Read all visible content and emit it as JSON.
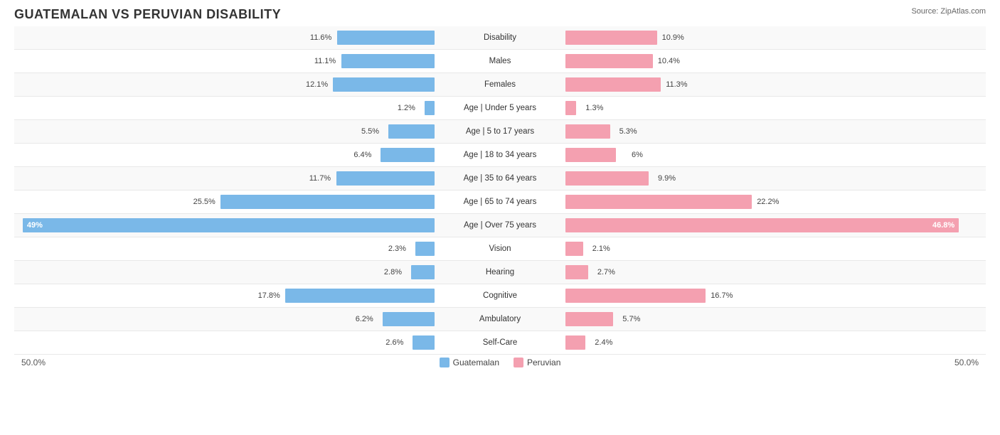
{
  "title": "GUATEMALAN VS PERUVIAN DISABILITY",
  "source": "Source: ZipAtlas.com",
  "footer": {
    "left": "50.0%",
    "right": "50.0%"
  },
  "legend": {
    "guatemalan_label": "Guatemalan",
    "peruvian_label": "Peruvian",
    "guatemalan_color": "#7ab8e8",
    "peruvian_color": "#f4a0b0"
  },
  "rows": [
    {
      "label": "Disability",
      "guatemalan": 11.6,
      "peruvian": 10.9,
      "max": 50
    },
    {
      "label": "Males",
      "guatemalan": 11.1,
      "peruvian": 10.4,
      "max": 50
    },
    {
      "label": "Females",
      "guatemalan": 12.1,
      "peruvian": 11.3,
      "max": 50
    },
    {
      "label": "Age | Under 5 years",
      "guatemalan": 1.2,
      "peruvian": 1.3,
      "max": 50
    },
    {
      "label": "Age | 5 to 17 years",
      "guatemalan": 5.5,
      "peruvian": 5.3,
      "max": 50
    },
    {
      "label": "Age | 18 to 34 years",
      "guatemalan": 6.4,
      "peruvian": 6.0,
      "max": 50
    },
    {
      "label": "Age | 35 to 64 years",
      "guatemalan": 11.7,
      "peruvian": 9.9,
      "max": 50
    },
    {
      "label": "Age | 65 to 74 years",
      "guatemalan": 25.5,
      "peruvian": 22.2,
      "max": 50
    },
    {
      "label": "Age | Over 75 years",
      "guatemalan": 49.0,
      "peruvian": 46.8,
      "max": 50,
      "full": true
    },
    {
      "label": "Vision",
      "guatemalan": 2.3,
      "peruvian": 2.1,
      "max": 50
    },
    {
      "label": "Hearing",
      "guatemalan": 2.8,
      "peruvian": 2.7,
      "max": 50
    },
    {
      "label": "Cognitive",
      "guatemalan": 17.8,
      "peruvian": 16.7,
      "max": 50
    },
    {
      "label": "Ambulatory",
      "guatemalan": 6.2,
      "peruvian": 5.7,
      "max": 50
    },
    {
      "label": "Self-Care",
      "guatemalan": 2.6,
      "peruvian": 2.4,
      "max": 50
    }
  ]
}
